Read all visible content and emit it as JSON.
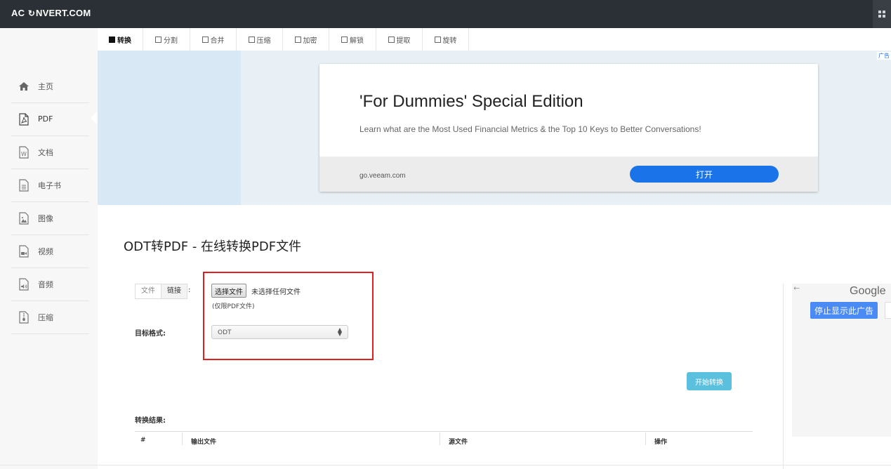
{
  "app": {
    "logo_prefix": "AC",
    "logo_symbol": "↻",
    "logo_suffix": "NVERT.COM"
  },
  "sidebar": {
    "items": [
      {
        "label": "主页",
        "icon": "home-icon"
      },
      {
        "label": "PDF",
        "icon": "pdf-file-icon",
        "active": true
      },
      {
        "label": "文档",
        "icon": "word-file-icon"
      },
      {
        "label": "电子书",
        "icon": "ebook-file-icon"
      },
      {
        "label": "图像",
        "icon": "image-file-icon"
      },
      {
        "label": "视频",
        "icon": "video-file-icon"
      },
      {
        "label": "音频",
        "icon": "audio-file-icon"
      },
      {
        "label": "压缩",
        "icon": "archive-file-icon"
      }
    ]
  },
  "tabs": [
    {
      "label": "转换",
      "active": true
    },
    {
      "label": "分割"
    },
    {
      "label": "合并"
    },
    {
      "label": "压缩"
    },
    {
      "label": "加密"
    },
    {
      "label": "解锁"
    },
    {
      "label": "提取"
    },
    {
      "label": "旋转"
    }
  ],
  "ad": {
    "badge": "广告",
    "title": "'For Dummies' Special Edition",
    "description": "Learn what are the Most Used Financial Metrics & the Top 10 Keys to Better Conversations!",
    "domain": "go.veeam.com",
    "open_label": "打开",
    "colors": {
      "button": "#1a73e8"
    }
  },
  "main": {
    "title": "ODT转PDF - 在线转换PDF文件",
    "source_tabs": {
      "file": "文件",
      "link": "链接",
      "colon": ":"
    },
    "choose_file_label": "选择文件",
    "no_file_text": "未选择任何文件",
    "pdf_only_hint": "(仅限PDF文件)",
    "target_format_label": "目标格式:",
    "target_format_value": "ODT",
    "start_button": "开始转换",
    "result_label": "转换结果:",
    "result_columns": [
      "#",
      "输出文件",
      "源文件",
      "操作"
    ]
  },
  "right_ad": {
    "google": "Google",
    "stop_label": "停止显示此广告"
  },
  "colors": {
    "topbar": "#2b3036",
    "highlight_box": "#e02020",
    "start_button": "#5bc0de"
  }
}
